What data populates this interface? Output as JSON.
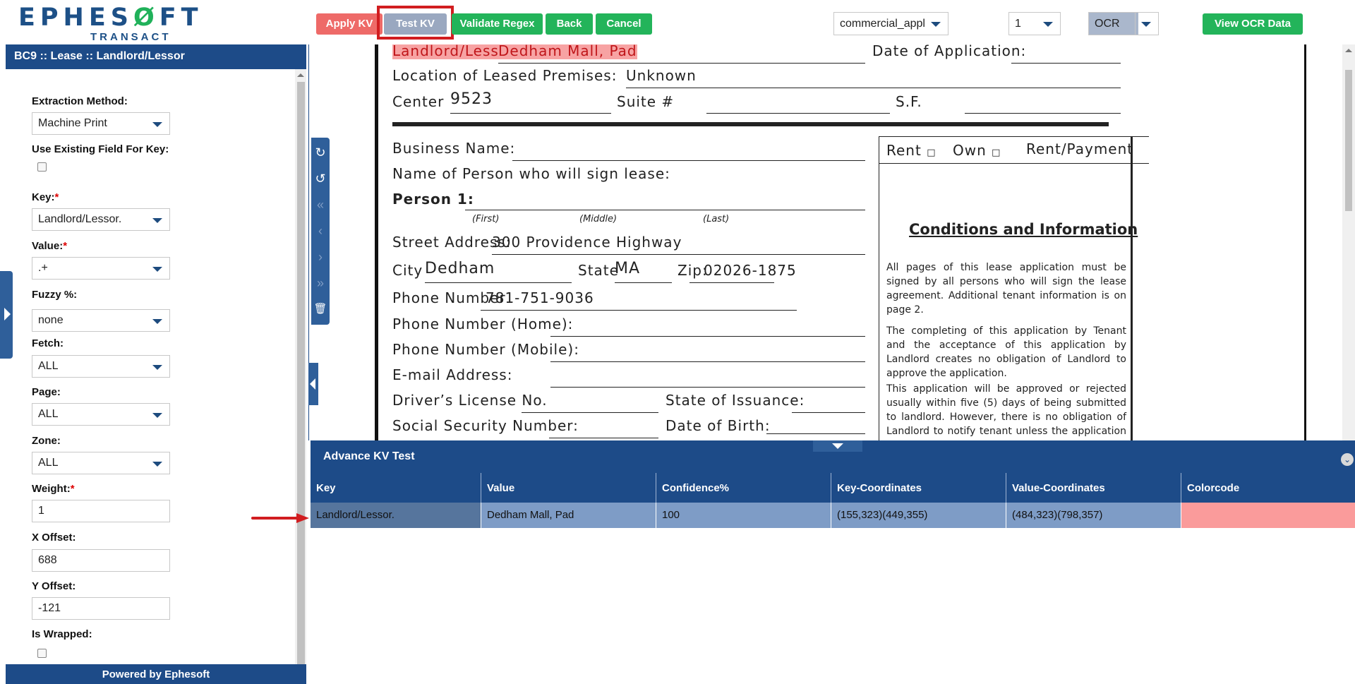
{
  "logo": {
    "word_a": "EPHES",
    "word_b": "Ø",
    "word_c": "FT",
    "sub": "TRANSACT"
  },
  "toolbar": {
    "apply_kv": "Apply KV",
    "test_kv": "Test KV",
    "validate_regex": "Validate Regex",
    "back": "Back",
    "cancel": "Cancel",
    "document_select": "commercial_appl",
    "page_select": "1",
    "ocr_select": "OCR",
    "view_ocr": "View OCR Data"
  },
  "left_panel": {
    "header": "BC9 :: Lease :: Landlord/Lessor",
    "footer": "Powered by Ephesoft",
    "extraction_method_label": "Extraction Method:",
    "extraction_method_value": "Machine Print",
    "use_existing_label": "Use Existing Field For Key:",
    "key_label": "Key:",
    "key_value": "Landlord/Lessor.",
    "value_label": "Value:",
    "value_value": ".+",
    "fuzzy_label": "Fuzzy %:",
    "fuzzy_value": "none",
    "fetch_label": "Fetch:",
    "fetch_value": "ALL",
    "page_label": "Page:",
    "page_value": "ALL",
    "zone_label": "Zone:",
    "zone_value": "ALL",
    "weight_label": "Weight:",
    "weight_value": "1",
    "x_offset_label": "X Offset:",
    "x_offset_value": "688",
    "y_offset_label": "Y Offset:",
    "y_offset_value": "-121",
    "is_wrapped_label": "Is Wrapped:",
    "required_mark": "*"
  },
  "document": {
    "landlord_label": "Landlord/Lessor:",
    "landlord_value": "Dedham Mall, Pad",
    "date_app": "Date of Application:",
    "location": "Location of Leased Premises:",
    "location_value": "Unknown",
    "center": "Center",
    "center_value": "9523",
    "suite": "Suite #",
    "sf": "S.F.",
    "business_name": "Business Name:",
    "person_sign": "Name of Person who will sign lease:",
    "person1": "Person 1:",
    "first": "(First)",
    "middle": "(Middle)",
    "last": "(Last)",
    "street": "Street Address:",
    "street_value": "300 Providence Highway",
    "city": "City",
    "city_value": "Dedham",
    "state": "State",
    "state_value": "MA",
    "zip": "Zip:",
    "zip_value": "02026-1875",
    "phone": "Phone Number",
    "phone_value": "781-751-9036",
    "phone_home": "Phone Number (Home):",
    "phone_mobile": "Phone Number (Mobile):",
    "email": "E-mail Address:",
    "license": "Driver’s License No.",
    "state_issuance": "State of Issuance:",
    "ssn": "Social Security Number:",
    "dob": "Date of Birth:",
    "rent": "Rent",
    "own": "Own",
    "rent_payment": "Rent/Payment",
    "box_glyph": "□",
    "conditions": "Conditions and Information",
    "para1": "All pages of this lease application must be signed by all persons who will sign the lease agreement. Additional tenant information is on page 2.",
    "para2": "The completing of this application by Tenant and the acceptance of this application by Landlord creates no obligation of Landlord to approve the application.",
    "para3": "This application will be approved or rejected usually within five (5) days of being submitted to landlord. However, there is no obligation of Landlord to notify tenant unless the application is approved."
  },
  "kv_test": {
    "title": "Advance KV Test",
    "columns": [
      "Key",
      "Value",
      "Confidence%",
      "Key-Coordinates",
      "Value-Coordinates",
      "Colorcode"
    ],
    "rows": [
      {
        "key": "Landlord/Lessor.",
        "value": "Dedham Mall, Pad",
        "confidence": "100",
        "key_coords": "(155,323)(449,355)",
        "value_coords": "(484,323)(798,357)",
        "colorcode": "#fa9b9b"
      }
    ]
  },
  "icons": {
    "refresh": "↻",
    "undo": "↺",
    "first": "«",
    "prev": "‹",
    "next": "›",
    "last": "»",
    "trash": "🗑",
    "chevron": "⌄"
  },
  "colors": {
    "brand_blue": "#1d4b88",
    "brand_green": "#23b45a",
    "apply_red": "#ee6a68",
    "highlight_red": "#d11d20",
    "row_blue": "#7e9cc6"
  }
}
